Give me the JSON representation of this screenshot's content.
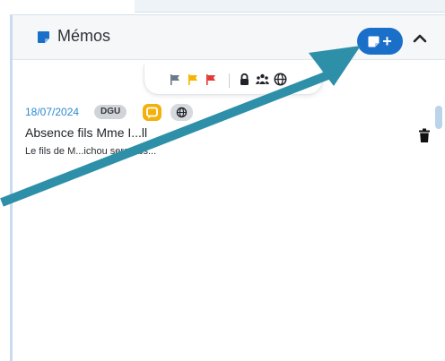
{
  "panel": {
    "title": "Mémos",
    "add_button_symbol": "+",
    "collapse_icon": "chevron-up-icon",
    "accent_color": "#1a6fc9"
  },
  "filters": {
    "flags": [
      {
        "icon": "flag-icon",
        "color": "#6b7885"
      },
      {
        "icon": "flag-icon",
        "color": "#f4b400"
      },
      {
        "icon": "flag-icon",
        "color": "#e53935"
      }
    ],
    "icons": [
      "lock-icon",
      "group-icon",
      "globe-icon"
    ]
  },
  "memos": [
    {
      "date": "18/07/2024",
      "author_tag": "DGU",
      "title": "Absence fils Mme I...ll",
      "excerpt": "Le fils de M...ichou sera abs...",
      "badges": [
        "comment-icon",
        "globe-icon"
      ],
      "date_color": "#2a8ad1"
    }
  ],
  "annotation": {
    "type": "arrow",
    "color": "#2e8fa8"
  }
}
